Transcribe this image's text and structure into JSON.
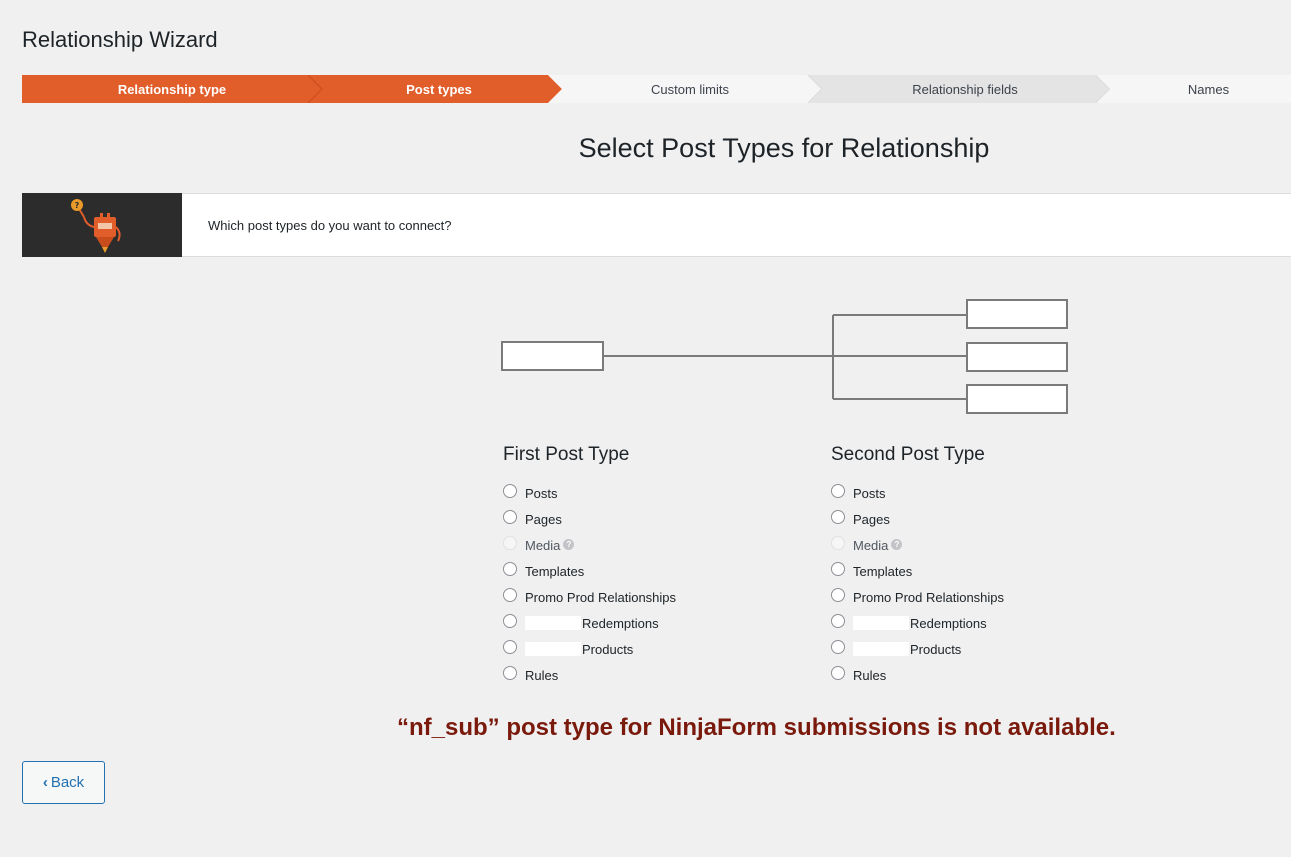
{
  "header": {
    "title": "Relationship Wizard"
  },
  "steps": [
    {
      "label": "Relationship type",
      "state": "completed"
    },
    {
      "label": "Post types",
      "state": "current"
    },
    {
      "label": "Custom limits",
      "state": "upcoming"
    },
    {
      "label": "Relationship fields",
      "state": "upcoming"
    },
    {
      "label": "Names",
      "state": "upcoming"
    }
  ],
  "colors": {
    "accent": "#e15d2a",
    "link": "#2271b1",
    "notice": "#7a1a0c"
  },
  "section": {
    "title": "Select Post Types for Relationship"
  },
  "info": {
    "text": "Which post types do you want to connect?",
    "mascot_icon": "robot-mascot-icon"
  },
  "first": {
    "heading": "First Post Type",
    "options": [
      {
        "label": "Posts"
      },
      {
        "label": "Pages"
      },
      {
        "label": "Media",
        "disabled": true
      },
      {
        "label": "Templates"
      },
      {
        "label": "Promo Prod Relationships"
      },
      {
        "label": "Redemptions"
      },
      {
        "label": "Products"
      },
      {
        "label": "Rules"
      }
    ]
  },
  "second": {
    "heading": "Second Post Type",
    "options": [
      {
        "label": "Posts"
      },
      {
        "label": "Pages"
      },
      {
        "label": "Media",
        "disabled": true
      },
      {
        "label": "Templates"
      },
      {
        "label": "Promo Prod Relationships"
      },
      {
        "label": "Redemptions"
      },
      {
        "label": "Products"
      },
      {
        "label": "Rules"
      }
    ]
  },
  "notice": {
    "text": "“nf_sub” post type for NinjaForm submissions is not available."
  },
  "footer": {
    "back_label": "Back"
  }
}
